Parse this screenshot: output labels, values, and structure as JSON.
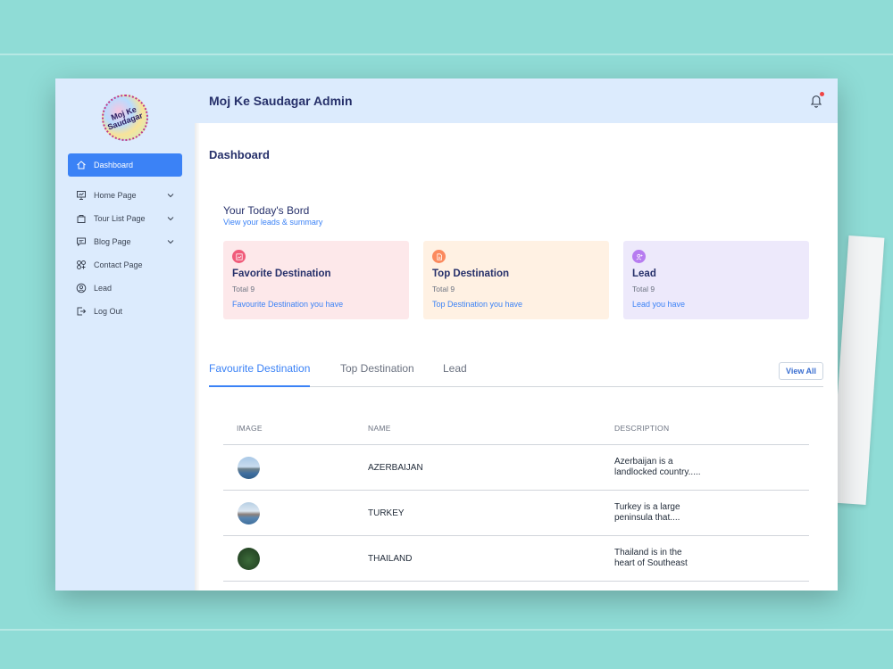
{
  "app": {
    "title": "Moj Ke Saudagar Admin"
  },
  "logo": {
    "line1": "Moj Ke",
    "line2": "Saudagar"
  },
  "sidebar": {
    "items": [
      {
        "label": "Dashboard",
        "icon": "home-icon",
        "active": true
      },
      {
        "label": "Home Page",
        "icon": "presentation-icon",
        "expandable": true
      },
      {
        "label": "Tour List Page",
        "icon": "bag-icon",
        "expandable": true
      },
      {
        "label": "Blog Page",
        "icon": "message-icon",
        "expandable": true
      },
      {
        "label": "Contact Page",
        "icon": "grid-icon"
      },
      {
        "label": "Lead",
        "icon": "user-circle-icon"
      },
      {
        "label": "Log Out",
        "icon": "logout-icon"
      }
    ]
  },
  "page": {
    "title": "Dashboard"
  },
  "board": {
    "title": "Your Today's Bord",
    "subtitle": "View your leads & summary",
    "cards": [
      {
        "title": "Favorite Destination",
        "total": "Total 9",
        "link": "Favourite Destination you have",
        "bg": "#fde8ea",
        "icon_bg": "#f05b7a",
        "icon": "chart-icon"
      },
      {
        "title": "Top Destination",
        "total": "Total 9",
        "link": "Top Destination you have",
        "bg": "#fff1e3",
        "icon_bg": "#fb8a5e",
        "icon": "document-icon"
      },
      {
        "title": "Lead",
        "total": "Total 9",
        "link": "Lead you have",
        "bg": "#ede9fb",
        "icon_bg": "#b77cf0",
        "icon": "user-add-icon"
      }
    ]
  },
  "tabs": {
    "items": [
      "Favourite Destination",
      "Top Destination",
      "Lead"
    ],
    "view_all": "View All"
  },
  "table": {
    "headers": [
      "IMAGE",
      "NAME",
      "DESCRIPTION"
    ],
    "rows": [
      {
        "name": "AZERBAIJAN",
        "desc1": "Azerbaijan is a",
        "desc2": "landlocked country.....",
        "thumb": "city"
      },
      {
        "name": "TURKEY",
        "desc1": "Turkey is a large",
        "desc2": "peninsula that....",
        "thumb": "sea"
      },
      {
        "name": "THAILAND",
        "desc1": "Thailand is in the",
        "desc2": "heart of Southeast",
        "thumb": "forest"
      }
    ]
  },
  "colors": {
    "accent": "#3b82f6",
    "sidebar_bg": "#dcebfd",
    "title": "#26306a",
    "notification_dot": "#ef4444"
  }
}
